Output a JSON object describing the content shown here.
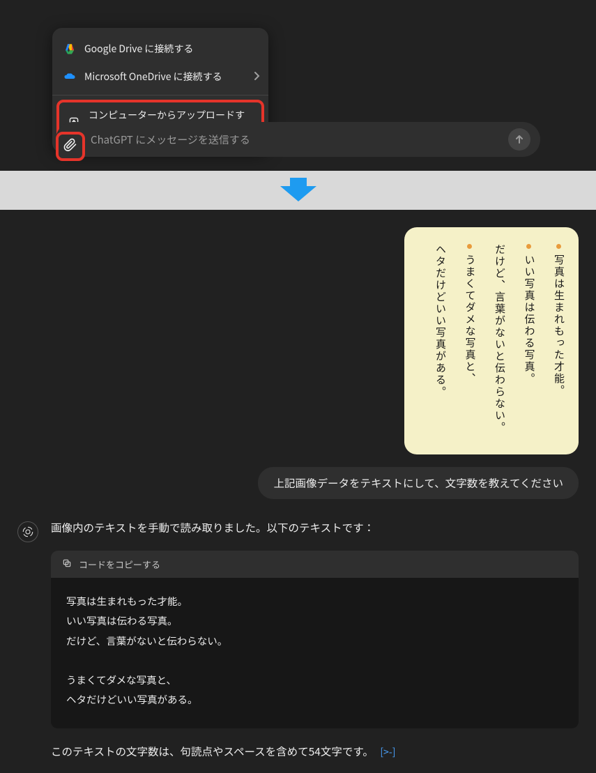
{
  "top": {
    "dropdown": {
      "item_gdrive": "Google Drive に接続する",
      "item_onedrive": "Microsoft OneDrive に接続する",
      "item_upload": "コンピューターからアップロードする"
    },
    "input_placeholder": "ChatGPT にメッセージを送信する"
  },
  "bottom": {
    "image_lines": {
      "l1": "写真は生まれもった才能。",
      "l2": "いい写真は伝わる写真。",
      "l3": "だけど、言葉がないと伝わらない。",
      "l4": "うまくてダメな写真と、",
      "l5": "ヘタだけどいい写真がある。"
    },
    "user_prompt": "上記画像データをテキストにして、文字数を教えてください",
    "assistant_intro": "画像内のテキストを手動で読み取りました。以下のテキストです：",
    "code_copy_label": "コードをコピーする",
    "code_body": "写真は生まれもった才能。\nいい写真は伝わる写真。\nだけど、言葉がないと伝わらない。\n\nうまくてダメな写真と、\nヘタだけどいい写真がある。",
    "assistant_count": "このテキストの文字数は、句読点やスペースを含めて54文字です。",
    "link_symbol": "[>-]"
  }
}
